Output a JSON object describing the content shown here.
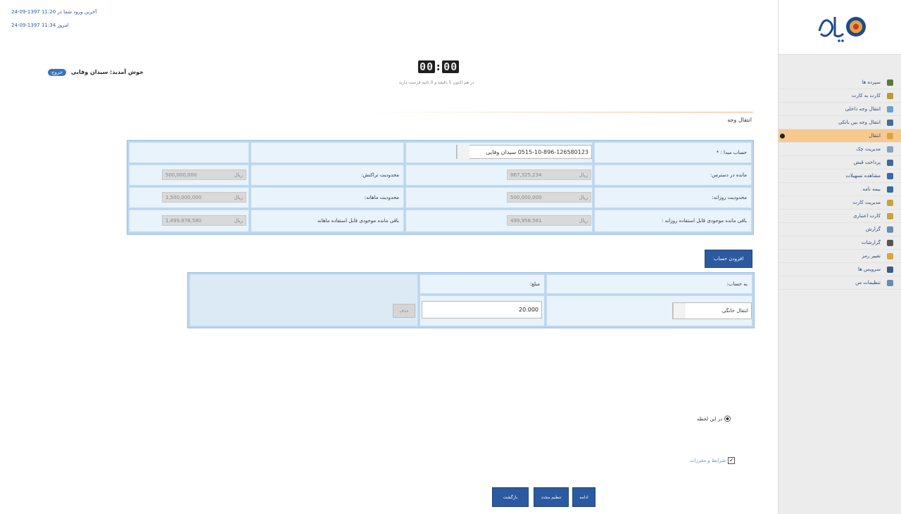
{
  "header": {
    "last_login": "آخرین ورود شما در 11:20 1397-09-24",
    "today": "امروز 11:34 1397-09-24",
    "welcome_label": "خوش آمدید: سیدان وفایی",
    "logout_label": "خروج"
  },
  "timer": {
    "minutes": "00",
    "seconds": "00",
    "caption": "در هم اکنون 5 دقیقه و 0 ثانیه فرصت دارید"
  },
  "section": {
    "title": "انتقال وجه"
  },
  "sidebar": {
    "items": [
      {
        "label": "سپرده ها",
        "icon": "deposits-icon",
        "color": "#5a7a3a"
      },
      {
        "label": "کارت به کارت",
        "icon": "card-to-card-icon",
        "color": "#b89a3a"
      },
      {
        "label": "انتقال وجه داخلی",
        "icon": "transfer-icon",
        "color": "#6aa0d0"
      },
      {
        "label": "انتقال وجه بین بانکی",
        "icon": "interbank-icon",
        "color": "#4a6a9a"
      },
      {
        "label": "انتقال",
        "icon": "paya-icon",
        "color": "#d9a441",
        "active": true
      },
      {
        "label": "مدیریت چک",
        "icon": "cheque-icon",
        "color": "#8aa0c0"
      },
      {
        "label": "پرداخت قبض",
        "icon": "bill-icon",
        "color": "#3a6aa0"
      },
      {
        "label": "مشاهده تسهیلات",
        "icon": "loan-icon",
        "color": "#3a6aa0"
      },
      {
        "label": "بیمه نامه",
        "icon": "insurance-icon",
        "color": "#3a6aa0"
      },
      {
        "label": "مدیریت کارت",
        "icon": "card-manage-icon",
        "color": "#c9a43a"
      },
      {
        "label": "کارت اعتباری",
        "icon": "credit-card-icon",
        "color": "#c9a43a"
      },
      {
        "label": "گزارش",
        "icon": "report-icon",
        "color": "#6a8ab0"
      },
      {
        "label": "گزارشات",
        "icon": "reports-icon",
        "color": "#555555"
      },
      {
        "label": "تغییر رمز",
        "icon": "password-icon",
        "color": "#d9a441"
      },
      {
        "label": "سرویس ها",
        "icon": "services-icon",
        "color": "#3a5a8a"
      },
      {
        "label": "تنظیمات من",
        "icon": "settings-icon",
        "color": "#6a8ab0"
      }
    ]
  },
  "info": {
    "source_label": "حساب مبدا : *",
    "source_value": "0515-10-896-126580123 سیدان وفایی",
    "balance_label": "مانده در دسترس:",
    "balance_value": "867,325,234",
    "daily_limit_label": "محدودیت روزانه:",
    "daily_limit_value": "500,000,000",
    "remaining_daily_label": "باقی مانده موجودی قابل استفاده روزانه :",
    "remaining_daily_value": "499,958,581",
    "tx_limit_label": "محدودیت تراکنش:",
    "tx_limit_value": "500,000,000",
    "monthly_limit_label": "محدودیت ماهانه:",
    "monthly_limit_value": "1,500,000,000",
    "remaining_monthly_label": "باقی مانده موجودی قابل استفاده ماهانه",
    "remaining_monthly_value": "1,499,878,580",
    "currency": "ریال"
  },
  "transfer": {
    "add_account_label": "افزودن حساب",
    "to_account_label": "به حساب:",
    "amount_label": "مبلغ:",
    "dest_value": "انتقال خانگی",
    "amount_value": "20.000",
    "remove_label": "حذف"
  },
  "options": {
    "radio_label": "در این لحظه",
    "terms_label": "شرایط و مقررات"
  },
  "buttons": {
    "continue": "ادامه",
    "schedule": "تنظیم مجدد",
    "back": "بازگشت"
  },
  "colors": {
    "accent": "#2c5aa0",
    "grid_bg": "#bcd5ef",
    "cell_bg": "#e8f3fb",
    "active_menu": "#f7c98f"
  }
}
